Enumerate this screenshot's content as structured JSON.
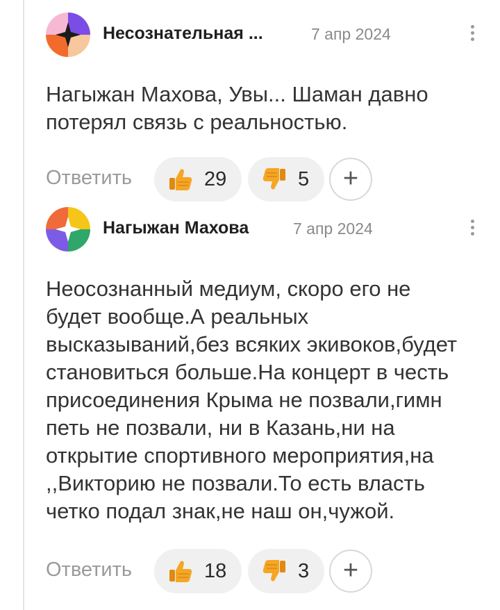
{
  "comments": [
    {
      "author": "Несознательная ...",
      "date": "7 апр 2024",
      "text": "Нагыжан Махова, Увы... Шаман давно потерял связь с реальностью.",
      "reply_label": "Ответить",
      "likes": "29",
      "dislikes": "5",
      "add_reaction": "+",
      "avatar_colors": [
        "#f7b8d4",
        "#7b4ce6",
        "#f36b2a",
        "#f7c79e"
      ]
    },
    {
      "author": "Нагыжан Махова",
      "date": "7 апр 2024",
      "text": "Неосознанный медиум, скоро его не будет вообще.А реальных высказываний,без всяких экивоков,будет становиться больше.На концерт в честь присоединения Крыма не позвали,гимн петь не позвали, ни в Казань,ни на открытие спортивного мероприятия,на ,,Викторию не позвали.То есть власть четко подал знак,не наш он,чужой.",
      "reply_label": "Ответить",
      "likes": "18",
      "dislikes": "3",
      "add_reaction": "+",
      "avatar_colors": [
        "#f06a3a",
        "#f5c518",
        "#7c5ce6",
        "#2fa66a"
      ]
    }
  ],
  "icons": {
    "thumbs_up": "thumbs-up-icon",
    "thumbs_down": "thumbs-down-icon",
    "more": "more-vertical-icon",
    "add": "plus-icon"
  },
  "colors": {
    "thumbs": "#f5a623",
    "text": "#333333",
    "muted": "#9a9a9a",
    "pill_bg": "#f0f0f0"
  }
}
